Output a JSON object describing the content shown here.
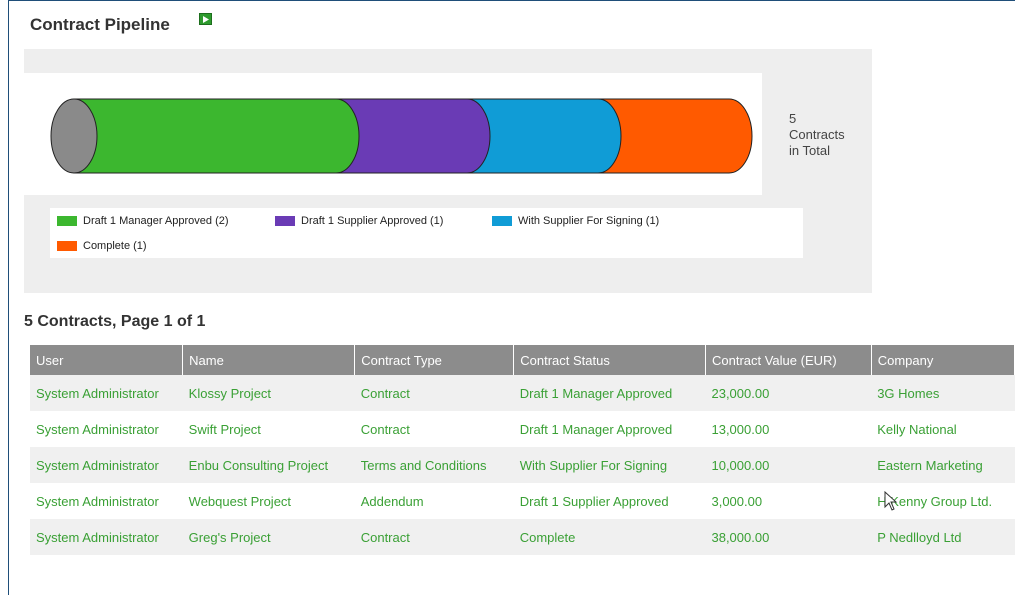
{
  "title": "Contract Pipeline",
  "chart": {
    "total_count": "5",
    "total_line1": "Contracts",
    "total_line2": "in Total",
    "legend": [
      {
        "label": "Draft 1 Manager Approved (2)",
        "color": "#3cb72f"
      },
      {
        "label": "Draft 1 Supplier Approved (1)",
        "color": "#6a3bb5"
      },
      {
        "label": "With Supplier For Signing (1)",
        "color": "#109cd6"
      },
      {
        "label": "Complete (1)",
        "color": "#ff5a00"
      }
    ]
  },
  "chart_data": {
    "type": "bar",
    "categories": [
      "Draft 1 Manager Approved",
      "Draft 1 Supplier Approved",
      "With Supplier For Signing",
      "Complete"
    ],
    "values": [
      2,
      1,
      1,
      1
    ]
  },
  "table": {
    "heading": "5 Contracts, Page 1 of 1",
    "columns": [
      "User",
      "Name",
      "Contract Type",
      "Contract Status",
      "Contract Value (EUR)",
      "Company"
    ],
    "rows": [
      [
        "System Administrator",
        "Klossy Project",
        "Contract",
        "Draft 1 Manager Approved",
        "23,000.00",
        "3G Homes"
      ],
      [
        "System Administrator",
        "Swift Project",
        "Contract",
        "Draft 1 Manager Approved",
        "13,000.00",
        "Kelly National"
      ],
      [
        "System Administrator",
        "Enbu Consulting Project",
        "Terms and Conditions",
        "With Supplier For Signing",
        "10,000.00",
        "Eastern Marketing"
      ],
      [
        "System Administrator",
        "Webquest Project",
        "Addendum",
        "Draft 1 Supplier Approved",
        "3,000.00",
        "H Kenny Group Ltd."
      ],
      [
        "System Administrator",
        "Greg's Project",
        "Contract",
        "Complete",
        "38,000.00",
        "P Nedlloyd Ltd"
      ]
    ]
  }
}
